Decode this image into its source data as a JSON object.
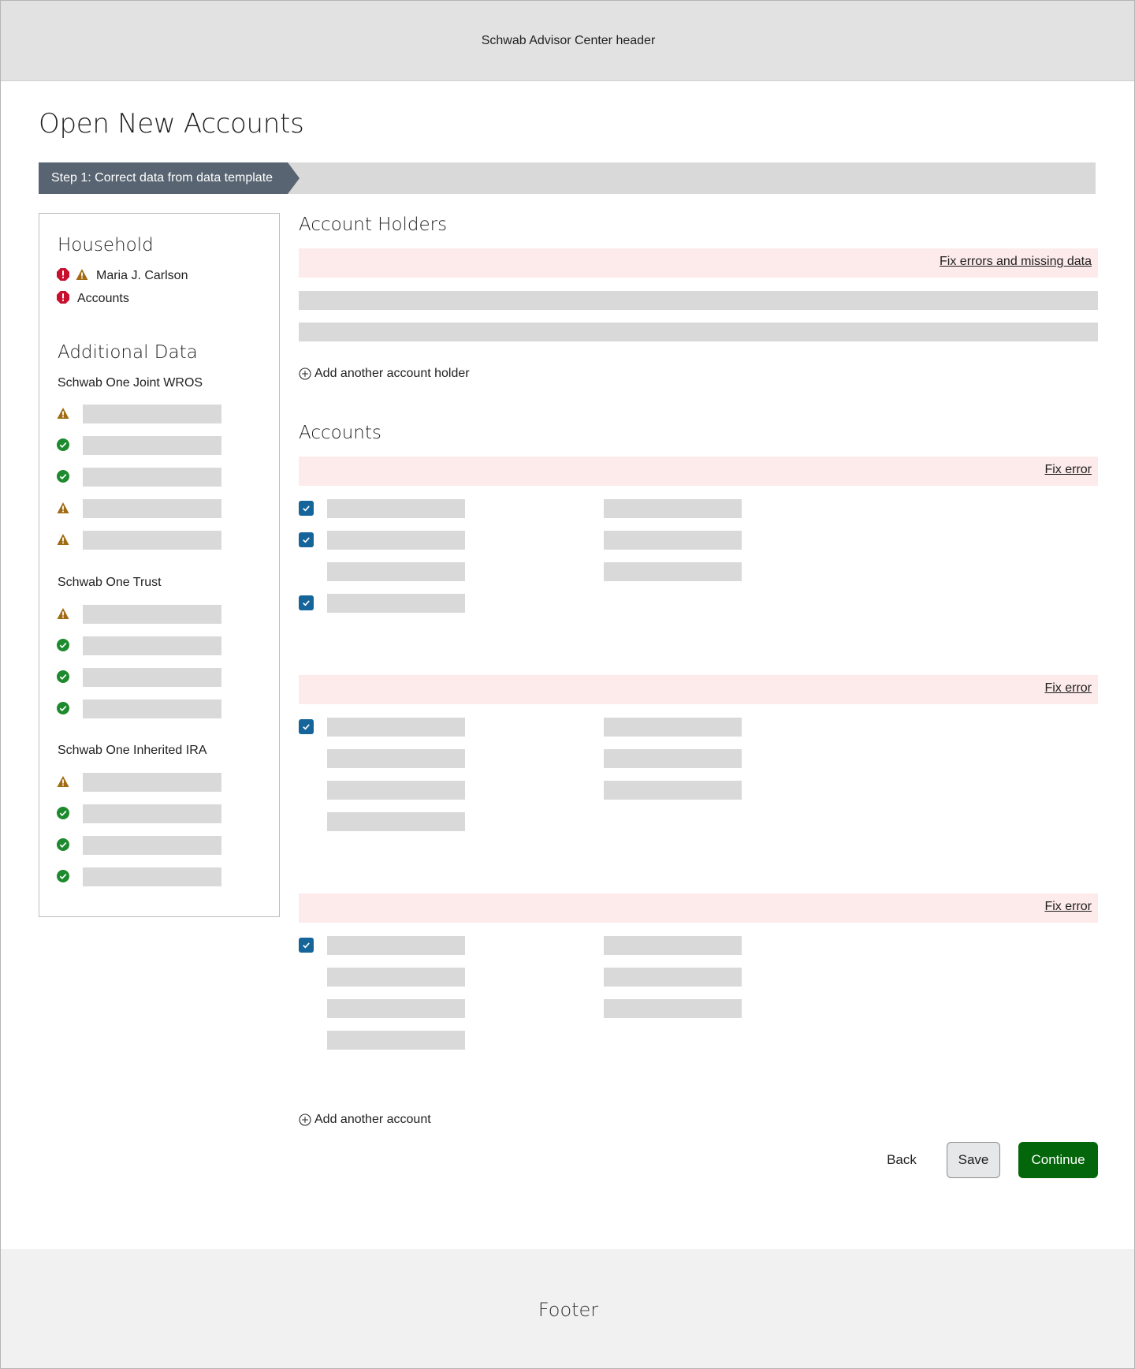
{
  "header": {
    "label": "Schwab Advisor Center header"
  },
  "page": {
    "title": "Open New Accounts"
  },
  "stepper": {
    "active_step": "Step 1: Correct data from data template"
  },
  "sidebar": {
    "household_heading": "Household",
    "household_items": [
      {
        "label": "Maria J. Carlson",
        "status": [
          "error",
          "warning"
        ]
      },
      {
        "label": "Accounts",
        "status": [
          "error"
        ]
      }
    ],
    "additional_heading": "Additional Data",
    "groups": [
      {
        "title": "Schwab One Joint WROS",
        "rows": [
          "warning",
          "success",
          "success",
          "warning",
          "warning"
        ]
      },
      {
        "title": "Schwab One Trust",
        "rows": [
          "warning",
          "success",
          "success",
          "success"
        ]
      },
      {
        "title": "Schwab One Inherited IRA",
        "rows": [
          "warning",
          "success",
          "success",
          "success"
        ]
      }
    ]
  },
  "account_holders": {
    "title": "Account Holders",
    "alert_link": "Fix errors and missing data",
    "add_link": "Add another account holder"
  },
  "accounts": {
    "title": "Accounts",
    "cards": [
      {
        "alert_link": "Fix error",
        "checked_rows": [
          1,
          2,
          4
        ]
      },
      {
        "alert_link": "Fix error",
        "checked_rows": [
          1
        ]
      },
      {
        "alert_link": "Fix error",
        "checked_rows": [
          1
        ]
      }
    ],
    "add_link": "Add another account"
  },
  "actions": {
    "back": "Back",
    "save": "Save",
    "continue": "Continue"
  },
  "footer": {
    "label": "Footer"
  },
  "colors": {
    "error": "#c8102e",
    "warning": "#a06b12",
    "success": "#1e8a2e",
    "checkbox": "#16659a",
    "primary_button": "#04660b",
    "alert_band": "#fdeaea",
    "step_active": "#586471"
  }
}
